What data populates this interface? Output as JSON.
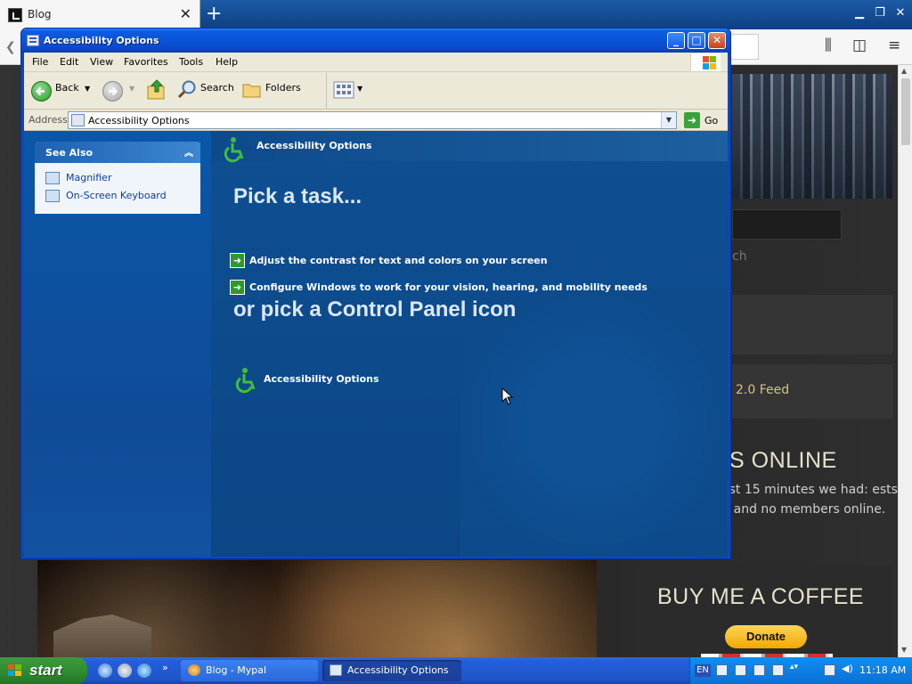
{
  "browser": {
    "tab_title": "Blog",
    "new_tab_icon": "plus-icon",
    "close_tab_icon": "close-icon",
    "sidebar": {
      "search_fragment": "ch",
      "rss_text": "2.0 Feed",
      "online_heading": "S ONLINE",
      "online_text": "ast 15 minutes we had: ests and no members online.",
      "coffee_heading": "BUY ME A COFFEE",
      "donate_label": "Donate"
    }
  },
  "window": {
    "title": "Accessibility Options",
    "menu": [
      "File",
      "Edit",
      "View",
      "Favorites",
      "Tools",
      "Help"
    ],
    "toolbar": {
      "back": "Back",
      "search": "Search",
      "folders": "Folders"
    },
    "address": {
      "label": "Address",
      "value": "Accessibility Options",
      "go": "Go"
    },
    "see_also": {
      "title": "See Also",
      "items": [
        "Magnifier",
        "On-Screen Keyboard"
      ]
    },
    "main": {
      "header": "Accessibility Options",
      "pick_task": "Pick a task...",
      "tasks": [
        "Adjust the contrast for text and colors on your screen",
        "Configure Windows to work for your vision, hearing, and mobility needs"
      ],
      "pick_icon": "or pick a Control Panel icon",
      "icon_label": "Accessibility Options"
    }
  },
  "taskbar": {
    "start": "start",
    "tasks": [
      "Blog - Mypal",
      "Accessibility Options"
    ],
    "language": "EN",
    "clock": "11:18 AM"
  },
  "colors": {
    "title_blue": "#0a54d8",
    "content_blue": "#0e4f92",
    "start_green": "#2e8a2e",
    "task_arrow_green": "#2c9a2c"
  }
}
